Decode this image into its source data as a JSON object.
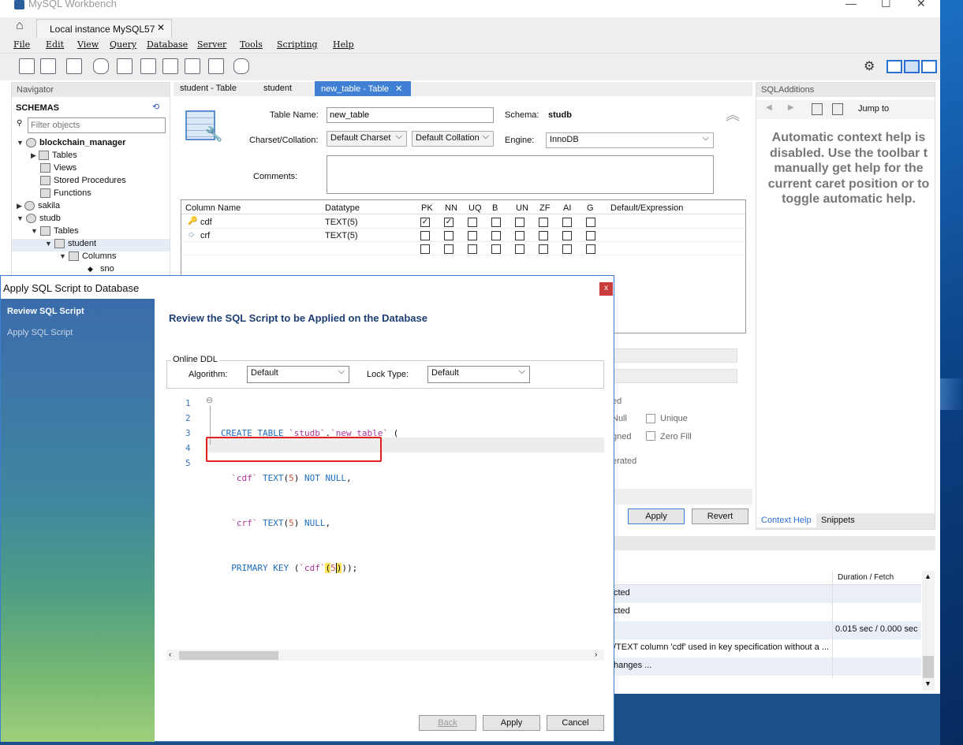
{
  "app": {
    "title": "MySQL Workbench",
    "home_tab": "Local instance MySQL57"
  },
  "menu": [
    "File",
    "Edit",
    "View",
    "Query",
    "Database",
    "Server",
    "Tools",
    "Scripting",
    "Help"
  ],
  "navigator": {
    "header": "Navigator",
    "schemas_label": "SCHEMAS",
    "filter_placeholder": "Filter objects",
    "tree": [
      {
        "label": "blockchain_manager",
        "level": 0,
        "bold": true,
        "expanded": true
      },
      {
        "label": "Tables",
        "level": 1
      },
      {
        "label": "Views",
        "level": 1
      },
      {
        "label": "Stored Procedures",
        "level": 1
      },
      {
        "label": "Functions",
        "level": 1
      },
      {
        "label": "sakila",
        "level": 0
      },
      {
        "label": "studb",
        "level": 0,
        "expanded": true
      },
      {
        "label": "Tables",
        "level": 1,
        "expanded": true
      },
      {
        "label": "student",
        "level": 2,
        "selected": true
      },
      {
        "label": "Columns",
        "level": 3
      },
      {
        "label": "sno",
        "level": 4
      }
    ]
  },
  "editor_tabs": [
    {
      "label": "student - Table",
      "active": false
    },
    {
      "label": "student",
      "active": false
    },
    {
      "label": "new_table - Table",
      "active": true
    }
  ],
  "table_form": {
    "table_name_label": "Table Name:",
    "table_name_value": "new_table",
    "schema_label": "Schema:",
    "schema_value": "studb",
    "charset_label": "Charset/Collation:",
    "charset_value": "Default Charset",
    "collation_value": "Default Collation",
    "engine_label": "Engine:",
    "engine_value": "InnoDB",
    "comments_label": "Comments:"
  },
  "columns_grid": {
    "headers": [
      "Column Name",
      "Datatype",
      "PK",
      "NN",
      "UQ",
      "B",
      "UN",
      "ZF",
      "AI",
      "G",
      "Default/Expression"
    ],
    "rows": [
      {
        "name": "cdf",
        "type": "TEXT(5)",
        "pk": true,
        "nn": true
      },
      {
        "name": "crf",
        "type": "TEXT(5)",
        "pk": false,
        "nn": false
      }
    ]
  },
  "column_details_partial": {
    "frag1": "ed",
    "frag2": "Null",
    "unique": "Unique",
    "frag3": "gned",
    "zero_fill": "Zero Fill",
    "frag4": "erated",
    "apply": "Apply",
    "revert": "Revert"
  },
  "sql_additions": {
    "header": "SQLAdditions",
    "jump_to": "Jump to",
    "help_text": "Automatic context help is disabled. Use the toolbar t manually get help for the current caret position or to toggle automatic help.",
    "tabs": [
      "Context Help",
      "Snippets"
    ]
  },
  "output": {
    "duration_header": "Duration / Fetch",
    "rows": [
      {
        "message": "cted",
        "duration": ""
      },
      {
        "message": "cted",
        "duration": ""
      },
      {
        "message": "",
        "duration": "0.015 sec / 0.000 sec"
      },
      {
        "message": "/TEXT column 'cdf' used in key specification without a ...",
        "duration": ""
      },
      {
        "message": "hanges ...",
        "duration": ""
      }
    ]
  },
  "dialog": {
    "title": "Apply SQL Script to Database",
    "close": "x",
    "steps": [
      "Review SQL Script",
      "Apply SQL Script"
    ],
    "heading": "Review the SQL Script to be Applied on the Database",
    "online_ddl": "Online DDL",
    "algorithm_label": "Algorithm:",
    "algorithm_value": "Default",
    "lock_label": "Lock Type:",
    "lock_value": "Default",
    "line_numbers": [
      "1",
      "2",
      "3",
      "4",
      "5"
    ],
    "buttons": {
      "back": "Back",
      "apply": "Apply",
      "cancel": "Cancel"
    }
  },
  "colors": {
    "accent": "#1f6cbd",
    "tab_active": "#3f7fd4",
    "highlight_box": "#e02020",
    "dialog_heading": "#1d3f73"
  }
}
